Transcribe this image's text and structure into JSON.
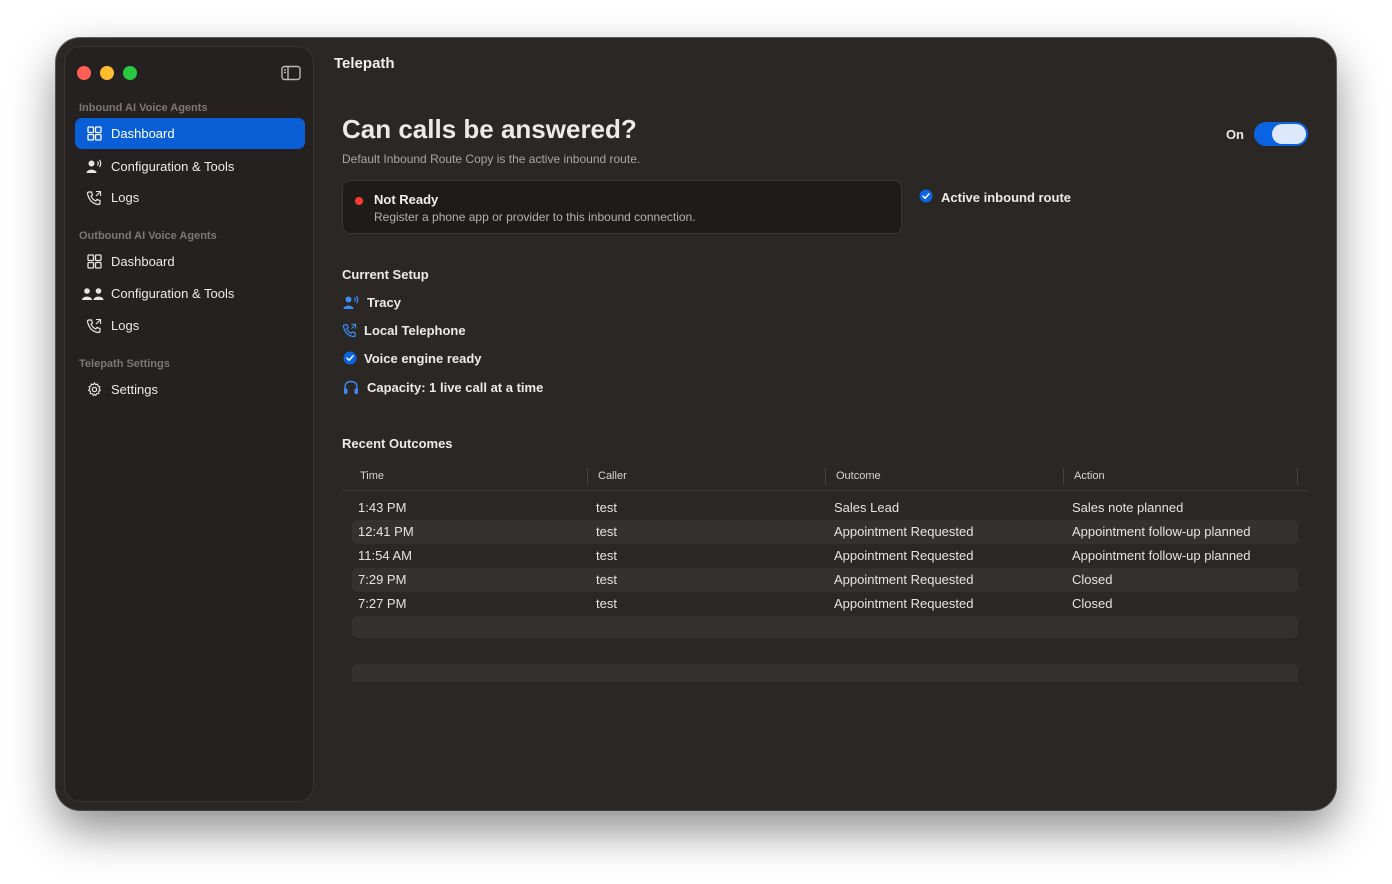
{
  "app": {
    "title": "Telepath"
  },
  "sidebar": {
    "sections": [
      {
        "label": "Inbound AI Voice Agents"
      },
      {
        "label": "Outbound AI Voice Agents"
      },
      {
        "label": "Telepath Settings"
      }
    ],
    "inbound": [
      {
        "label": "Dashboard",
        "icon": "grid-icon",
        "active": true
      },
      {
        "label": "Configuration & Tools",
        "icon": "person-wave-icon"
      },
      {
        "label": "Logs",
        "icon": "phone-log-icon"
      }
    ],
    "outbound": [
      {
        "label": "Dashboard",
        "icon": "grid-icon"
      },
      {
        "label": "Configuration & Tools",
        "icon": "people-icon"
      },
      {
        "label": "Logs",
        "icon": "phone-log-icon"
      }
    ],
    "settings": [
      {
        "label": "Settings",
        "icon": "gear-icon"
      }
    ]
  },
  "hero": {
    "title": "Can calls be answered?",
    "subtitle": "Default Inbound Route Copy is the active inbound route.",
    "toggle_label": "On",
    "toggle_on": true
  },
  "status": {
    "title": "Not Ready",
    "description": "Register a phone app or provider to this inbound connection.",
    "dot_color": "#ff3b30",
    "active_route_label": "Active inbound route"
  },
  "setup": {
    "heading": "Current Setup",
    "items": [
      {
        "icon": "person-wave-icon",
        "label": "Tracy"
      },
      {
        "icon": "phone-icon",
        "label": "Local Telephone"
      },
      {
        "icon": "checkmark-circle-icon",
        "label": "Voice engine ready"
      },
      {
        "icon": "headset-icon",
        "label": "Capacity: 1 live call at a time"
      }
    ]
  },
  "outcomes": {
    "heading": "Recent Outcomes",
    "columns": [
      "Time",
      "Caller",
      "Outcome",
      "Action"
    ],
    "rows": [
      [
        "1:43 PM",
        "test",
        "Sales Lead",
        "Sales note planned"
      ],
      [
        "12:41 PM",
        "test",
        "Appointment Requested",
        "Appointment follow-up planned"
      ],
      [
        "11:54 AM",
        "test",
        "Appointment Requested",
        "Appointment follow-up planned"
      ],
      [
        "7:29 PM",
        "test",
        "Appointment Requested",
        "Closed"
      ],
      [
        "7:27 PM",
        "test",
        "Appointment Requested",
        "Closed"
      ]
    ]
  },
  "colors": {
    "accent": "#0a5fd6",
    "window_bg": "#2a2725",
    "sidebar_bg": "#242120",
    "status_red": "#ff3b30"
  }
}
